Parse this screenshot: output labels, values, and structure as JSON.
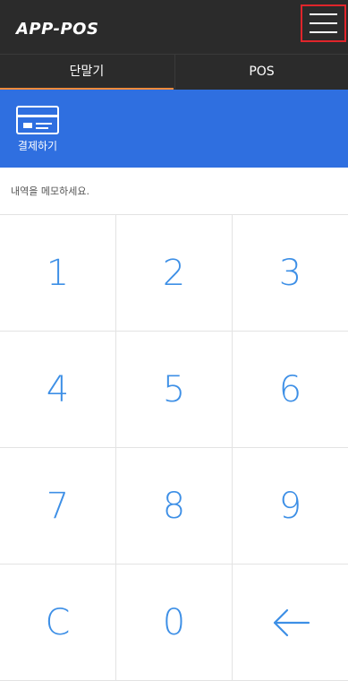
{
  "header": {
    "logo": "APP-POS",
    "menu_icon": "hamburger-menu-icon"
  },
  "tabs": [
    {
      "label": "단말기",
      "active": true
    },
    {
      "label": "POS",
      "active": false
    }
  ],
  "payment": {
    "label": "결제하기",
    "icon": "credit-card-icon"
  },
  "memo": {
    "placeholder": "내역을 메모하세요.",
    "value": ""
  },
  "keypad": {
    "keys": [
      "1",
      "2",
      "3",
      "4",
      "5",
      "6",
      "7",
      "8",
      "9",
      "C",
      "0"
    ],
    "backspace_icon": "backspace-arrow-icon"
  },
  "colors": {
    "header_bg": "#2b2b2b",
    "active_tab_underline": "#f08a3c",
    "pay_bar_bg": "#2f6fe0",
    "key_text": "#3d8fe6",
    "menu_highlight": "#e0252b"
  }
}
